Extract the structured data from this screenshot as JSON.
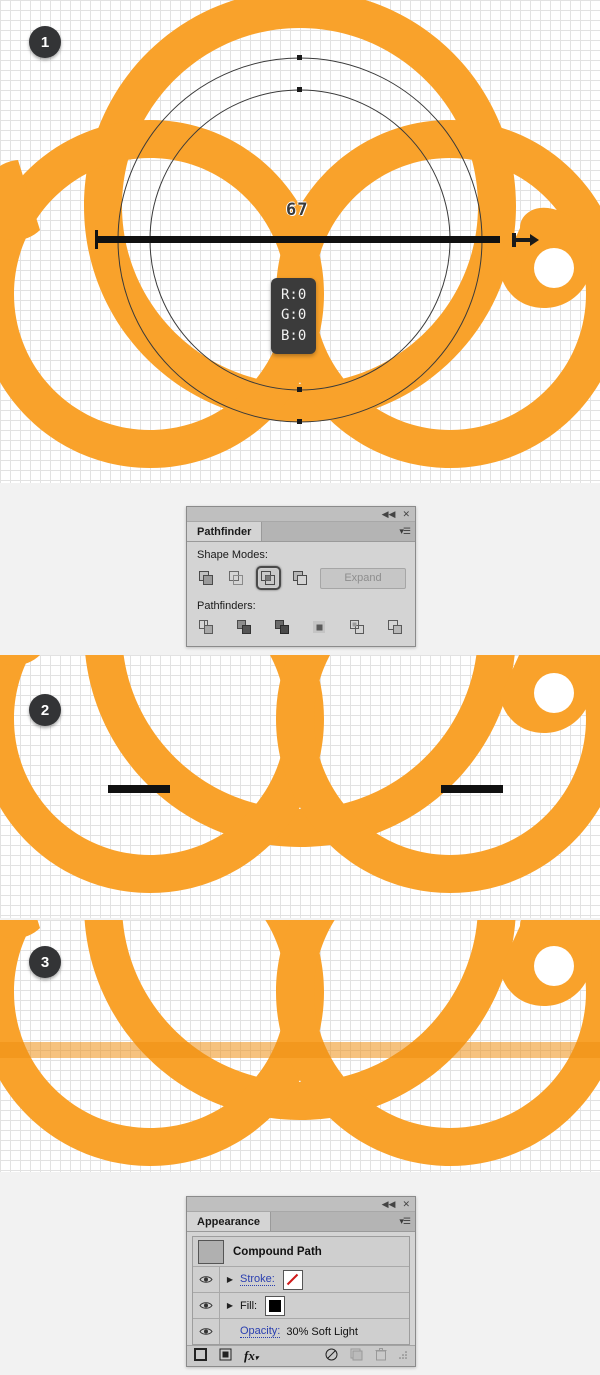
{
  "steps": [
    {
      "number": "1"
    },
    {
      "number": "2"
    },
    {
      "number": "3"
    }
  ],
  "canvas1": {
    "measure_label": "67",
    "rgb_tooltip": {
      "r": "R:0",
      "g": "G:0",
      "b": "B:0"
    },
    "artwork_color": "#f9a22b",
    "selection_stroke": "#3a3a3a",
    "cursor_icon": "measure-tool-cursor"
  },
  "canvas2": {
    "artwork_color": "#f9a22b",
    "marker_color": "#111111"
  },
  "canvas3": {
    "artwork_color": "#f9a22b",
    "overlay_color": "#f29318"
  },
  "pathfinder_panel": {
    "tab_label": "Pathfinder",
    "collapse_icon": "collapse-icon",
    "close_icon": "close-icon",
    "menu_icon": "panel-menu-icon",
    "shape_modes_label": "Shape Modes:",
    "pathfinders_label": "Pathfinders:",
    "expand_label": "Expand",
    "shape_modes": [
      {
        "name": "unite-icon",
        "selected": false
      },
      {
        "name": "minus-front-icon",
        "selected": false
      },
      {
        "name": "intersect-icon",
        "selected": true
      },
      {
        "name": "exclude-icon",
        "selected": false
      }
    ],
    "pathfinders": [
      {
        "name": "divide-icon"
      },
      {
        "name": "trim-icon"
      },
      {
        "name": "merge-icon"
      },
      {
        "name": "crop-icon"
      },
      {
        "name": "outline-icon"
      },
      {
        "name": "minus-back-icon"
      }
    ]
  },
  "appearance_panel": {
    "tab_label": "Appearance",
    "collapse_icon": "collapse-icon",
    "close_icon": "close-icon",
    "menu_icon": "panel-menu-icon",
    "object_title": "Compound Path",
    "rows": [
      {
        "label": "Stroke:",
        "value": "",
        "swatch": "none-red-slash",
        "eye": "visibility-icon",
        "arrow": "disclosure-triangle"
      },
      {
        "label": "Fill:",
        "value": "",
        "swatch": "black-fill",
        "eye": "visibility-icon",
        "arrow": "disclosure-triangle"
      },
      {
        "label": "Opacity:",
        "value": "30% Soft Light",
        "swatch": "",
        "eye": "visibility-icon",
        "arrow": ""
      }
    ],
    "footer_icons": [
      "add-new-stroke-icon",
      "add-new-fill-icon",
      "add-new-effect-icon",
      "clear-appearance-icon",
      "duplicate-item-icon",
      "delete-item-icon",
      "resize-grip-icon"
    ]
  }
}
